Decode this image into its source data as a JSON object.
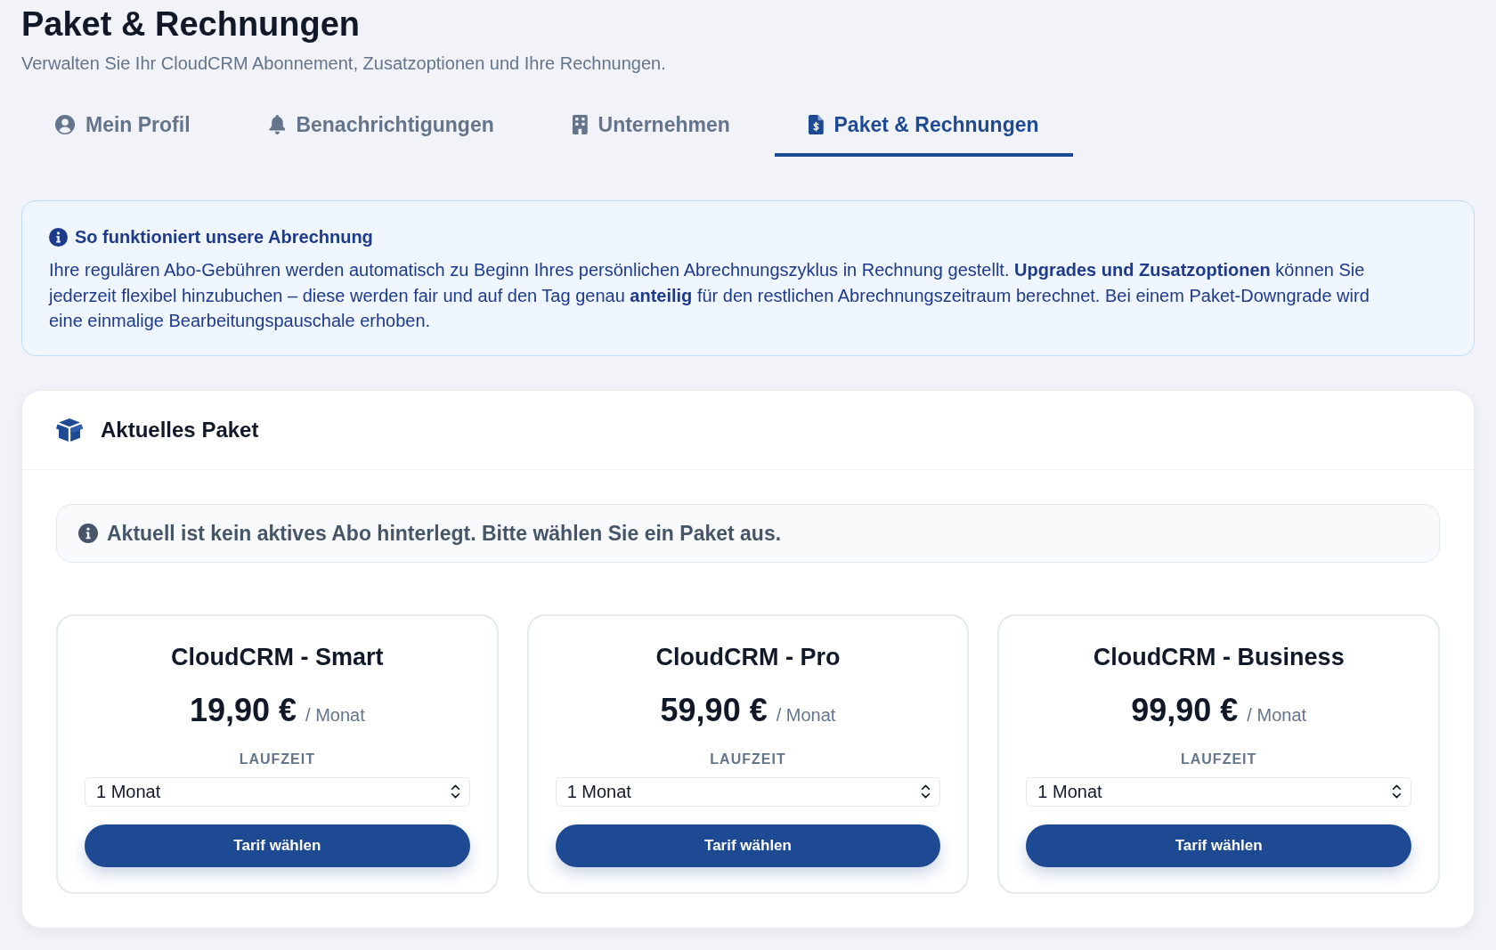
{
  "header": {
    "title": "Paket & Rechnungen",
    "subtitle": "Verwalten Sie Ihr CloudCRM Abonnement, Zusatzoptionen und Ihre Rechnungen."
  },
  "tabs": [
    {
      "label": "Mein Profil",
      "selected": false
    },
    {
      "label": "Benachrichtigungen",
      "selected": false
    },
    {
      "label": "Unternehmen",
      "selected": false
    },
    {
      "label": "Paket & Rechnungen",
      "selected": true
    }
  ],
  "billing_info": {
    "title": "So funktioniert unsere Abrechnung",
    "text": "Ihre regulären Abo-Gebühren werden automatisch zu Beginn Ihres persönlichen Abrechnungszyklus in Rechnung gestellt. **Upgrades und Zusatzoptionen** können Sie jederzeit flexibel hinzubuchen – diese werden fair und auf den Tag genau **anteilig** für den restlichen Abrechnungszeitraum berechnet. Bei einem Paket-Downgrade wird eine einmalige Bearbeitungspauschale erhoben."
  },
  "current_plan": {
    "title": "Aktuelles Paket",
    "notice": "Aktuell ist kein aktives Abo hinterlegt. Bitte wählen Sie ein Paket aus.",
    "plans": [
      {
        "name": "CloudCRM - Smart",
        "price": "19,90 €",
        "period": "/ Monat",
        "term_label": "LAUFZEIT",
        "term": "1 Monat",
        "button": "Tarif wählen"
      },
      {
        "name": "CloudCRM - Pro",
        "price": "59,90 €",
        "period": "/ Monat",
        "term_label": "LAUFZEIT",
        "term": "1 Monat",
        "button": "Tarif wählen"
      },
      {
        "name": "CloudCRM - Business",
        "price": "99,90 €",
        "period": "/ Monat",
        "term_label": "LAUFZEIT",
        "term": "1 Monat",
        "button": "Tarif wählen"
      }
    ]
  }
}
